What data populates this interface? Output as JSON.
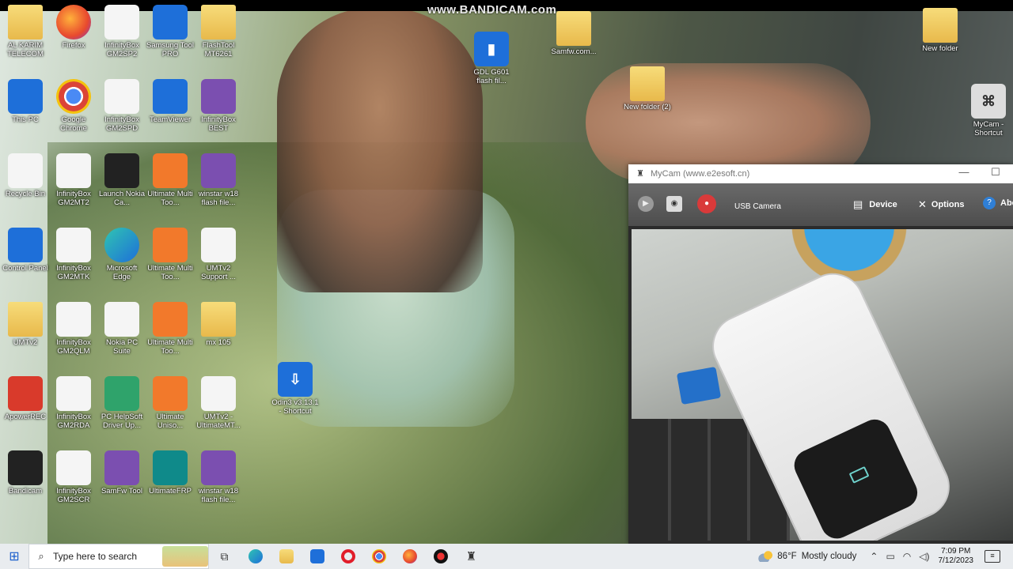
{
  "watermark": "www.BANDICAM.com",
  "desktop_icons": [
    {
      "label": "AL KARIM TELECOM",
      "icon": "contact-folder-icon",
      "col": 0,
      "row": 0
    },
    {
      "label": "Firefox",
      "icon": "firefox-icon",
      "col": 1,
      "row": 0
    },
    {
      "label": "InfinityBox GM2SP2",
      "icon": "infinitybox-icon",
      "col": 2,
      "row": 0
    },
    {
      "label": "Samsung Tool PRO",
      "icon": "gear-icon",
      "col": 3,
      "row": 0
    },
    {
      "label": "FlashTool MT6261",
      "icon": "folder-icon",
      "col": 4,
      "row": 0
    },
    {
      "label": "This PC",
      "icon": "computer-icon",
      "col": 0,
      "row": 1
    },
    {
      "label": "Google Chrome",
      "icon": "chrome-icon",
      "col": 1,
      "row": 1
    },
    {
      "label": "InfinityBox GM2SPD",
      "icon": "infinitybox-icon",
      "col": 2,
      "row": 1
    },
    {
      "label": "TeamViewer",
      "icon": "teamviewer-icon",
      "col": 3,
      "row": 1
    },
    {
      "label": "InfinityBox BEST",
      "icon": "infinitybox-best-icon",
      "col": 4,
      "row": 1
    },
    {
      "label": "Recycle Bin",
      "icon": "recycle-bin-icon",
      "col": 0,
      "row": 2
    },
    {
      "label": "InfinityBox GM2MT2",
      "icon": "infinitybox-icon",
      "col": 1,
      "row": 2
    },
    {
      "label": "Launch Nokia Ca...",
      "icon": "nokia-icon",
      "col": 2,
      "row": 2
    },
    {
      "label": "Ultimate Multi Too...",
      "icon": "ultimate-icon",
      "col": 3,
      "row": 2
    },
    {
      "label": "winstar w18 flash file...",
      "icon": "winrar-icon",
      "col": 4,
      "row": 2
    },
    {
      "label": "Control Panel",
      "icon": "control-panel-icon",
      "col": 0,
      "row": 3
    },
    {
      "label": "InfinityBox GM2MTK",
      "icon": "infinitybox-icon",
      "col": 1,
      "row": 3
    },
    {
      "label": "Microsoft Edge",
      "icon": "edge-icon",
      "col": 2,
      "row": 3
    },
    {
      "label": "Ultimate Multi Too...",
      "icon": "ultimate-icon",
      "col": 3,
      "row": 3
    },
    {
      "label": "UMTv2 Support ...",
      "icon": "document-icon",
      "col": 4,
      "row": 3
    },
    {
      "label": "UMTv2",
      "icon": "folder-icon",
      "col": 0,
      "row": 4
    },
    {
      "label": "InfinityBox GM2QLM",
      "icon": "infinitybox-icon",
      "col": 1,
      "row": 4
    },
    {
      "label": "Nokia PC Suite",
      "icon": "nokia-pc-suite-icon",
      "col": 2,
      "row": 4
    },
    {
      "label": "Ultimate Multi Too...",
      "icon": "ultimate-icon",
      "col": 3,
      "row": 4
    },
    {
      "label": "mx 105",
      "icon": "folder-icon",
      "col": 4,
      "row": 4
    },
    {
      "label": "ApowerREC",
      "icon": "apowerrec-icon",
      "col": 0,
      "row": 5
    },
    {
      "label": "InfinityBox GM2RDA",
      "icon": "infinitybox-icon",
      "col": 1,
      "row": 5
    },
    {
      "label": "PC HelpSoft Driver Up...",
      "icon": "driver-updater-icon",
      "col": 2,
      "row": 5
    },
    {
      "label": "Ultimate Uniso...",
      "icon": "ultimate-icon",
      "col": 3,
      "row": 5
    },
    {
      "label": "UMTv2 - UltimateMT...",
      "icon": "umt-window-icon",
      "col": 4,
      "row": 5
    },
    {
      "label": "Bandicam",
      "icon": "bandicam-icon",
      "col": 0,
      "row": 6
    },
    {
      "label": "InfinityBox GM2SCR",
      "icon": "infinitybox-icon",
      "col": 1,
      "row": 6
    },
    {
      "label": "SamFw Tool",
      "icon": "samfw-icon",
      "col": 2,
      "row": 6
    },
    {
      "label": "UltimateFRP",
      "icon": "ultimatefrp-icon",
      "col": 3,
      "row": 6
    },
    {
      "label": "winstar w18 flash file...",
      "icon": "winrar-icon",
      "col": 4,
      "row": 6
    }
  ],
  "floating_icons": [
    {
      "label": "GDL G601 flash fil...",
      "icon": "flash-file-icon"
    },
    {
      "label": "Samfw.com...",
      "icon": "folder-icon"
    },
    {
      "label": "New folder (2)",
      "icon": "folder-icon"
    },
    {
      "label": "Odin3 v3.13.1 - Shortcut",
      "icon": "odin-icon"
    },
    {
      "label": "New folder",
      "icon": "winrar-folder-icon"
    },
    {
      "label": "MyCam - Shortcut",
      "icon": "camera-icon"
    }
  ],
  "mycam": {
    "title": "MyCam (www.e2esoft.cn)",
    "play_icon": "play-icon",
    "snapshot_icon": "camera-icon",
    "record_icon": "record-icon",
    "camera_name": "USB Camera",
    "device_label": "Device",
    "options_label": "Options",
    "about_label": "Abo",
    "minimize": "—",
    "maximize": "☐"
  },
  "taskbar": {
    "search_placeholder": "Type here to search",
    "apps": [
      "task-view-icon",
      "edge-icon",
      "file-explorer-icon",
      "mail-icon",
      "opera-icon",
      "chrome-icon",
      "firefox-icon",
      "bandicam-icon",
      "mycam-icon"
    ],
    "weather_temp": "86°F",
    "weather_text": "Mostly cloudy",
    "time": "7:09 PM",
    "date": "7/12/2023"
  },
  "colors": {
    "taskbar_bg": "#e9ecef",
    "mycam_toolbar": "#5a5a5a",
    "watermark": "#e9e9e9"
  }
}
